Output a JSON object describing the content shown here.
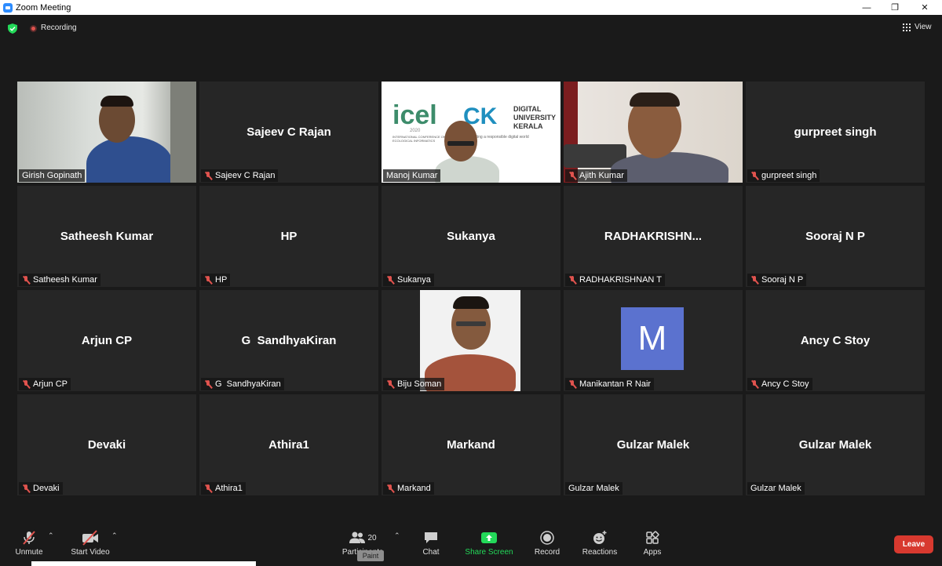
{
  "window": {
    "title": "Zoom Meeting",
    "minimize": "—",
    "restore": "❐",
    "close": "✕"
  },
  "status": {
    "recording_label": "Recording",
    "view_label": "View"
  },
  "tiles": [
    {
      "name": "Girish Gopinath",
      "label": "Girish Gopinath",
      "muted": false,
      "video": true
    },
    {
      "name": "Sajeev C Rajan",
      "label": "Sajeev C Rajan",
      "muted": true,
      "video": false
    },
    {
      "name": "Manoj Kumar",
      "label": "Manoj Kumar",
      "muted": false,
      "video": true
    },
    {
      "name": "Ajith Kumar",
      "label": "Ajith Kumar",
      "muted": true,
      "video": true
    },
    {
      "name": "gurpreet singh",
      "label": "gurpreet singh",
      "muted": true,
      "video": false
    },
    {
      "name": "Satheesh Kumar",
      "label": "Satheesh Kumar",
      "muted": true,
      "video": false
    },
    {
      "name": "HP",
      "label": "HP",
      "muted": true,
      "video": false
    },
    {
      "name": "Sukanya",
      "label": "Sukanya",
      "muted": true,
      "video": false
    },
    {
      "name": "RADHAKRISHN...",
      "label": "RADHAKRISHNAN T",
      "muted": true,
      "video": false
    },
    {
      "name": "Sooraj N P",
      "label": "Sooraj N P",
      "muted": true,
      "video": false
    },
    {
      "name": "Arjun CP",
      "label": "Arjun CP",
      "muted": true,
      "video": false
    },
    {
      "name": "G  SandhyaKiran",
      "label": "G  SandhyaKiran",
      "muted": true,
      "video": false
    },
    {
      "name": "Biju Soman",
      "label": "Biju Soman",
      "muted": true,
      "video": true
    },
    {
      "name": "Manikantan R Nair",
      "label": "Manikantan R Nair",
      "muted": true,
      "video": false,
      "avatar_letter": "M"
    },
    {
      "name": "Ancy C Stoy",
      "label": "Ancy C Stoy",
      "muted": true,
      "video": false
    },
    {
      "name": "Devaki",
      "label": "Devaki",
      "muted": true,
      "video": false
    },
    {
      "name": "Athira1",
      "label": "Athira1",
      "muted": true,
      "video": false
    },
    {
      "name": "Markand",
      "label": "Markand",
      "muted": true,
      "video": false
    },
    {
      "name": "Gulzar Malek",
      "label": "Gulzar Malek",
      "muted": false,
      "video": false
    },
    {
      "name": "Gulzar Malek",
      "label": "Gulzar Malek",
      "muted": false,
      "video": false
    }
  ],
  "manoj_background": {
    "logo_left": "icel",
    "logo_left_year": "2020",
    "logo_left_sub": "INTERNATIONAL CONFERENCE ON ECOLOGICAL INFORMATICS",
    "logo_right_mark": "CK",
    "logo_right_line1": "DIGITAL",
    "logo_right_line2": "UNIVERSITY",
    "logo_right_line3": "KERALA",
    "tagline": "...rating a responsible digital world"
  },
  "toolbar": {
    "unmute": "Unmute",
    "start_video": "Start Video",
    "participants": "Participants",
    "participants_count": "20",
    "chat": "Chat",
    "share_screen": "Share Screen",
    "record": "Record",
    "reactions": "Reactions",
    "apps": "Apps",
    "leave": "Leave",
    "tooltip": "Paint"
  },
  "colors": {
    "active_speaker_border": "#d3e36b",
    "share_green": "#23d959",
    "leave_red": "#d8392f",
    "avatar_blue": "#5b72cf",
    "muted_red": "#e0534e"
  }
}
